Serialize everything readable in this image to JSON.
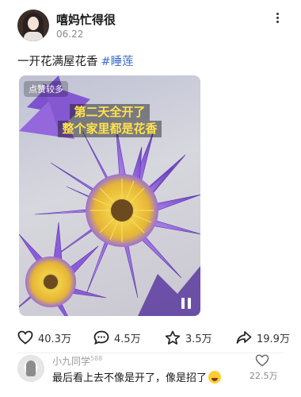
{
  "post": {
    "username": "嘻妈忙得很",
    "date": "06.22",
    "text": "一开花满屋花香",
    "hashtag": "#睡莲"
  },
  "media": {
    "badge": "点赞较多",
    "caption_line1": "第二天全开了",
    "caption_line2": "整个家里都是花香",
    "caption_color": "#ffe34a"
  },
  "actions": {
    "likes": "40.3万",
    "comments": "4.5万",
    "favorites": "3.5万",
    "shares": "19.9万"
  },
  "comment": {
    "author": "小九同学",
    "author_badge": "588",
    "text": "最后看上去不像是开了，像是招了",
    "likes": "22.5万"
  },
  "colors": {
    "hashtag": "#3c6cc8",
    "petal": "#8a5fd6",
    "stamen": "#e8c23a"
  }
}
